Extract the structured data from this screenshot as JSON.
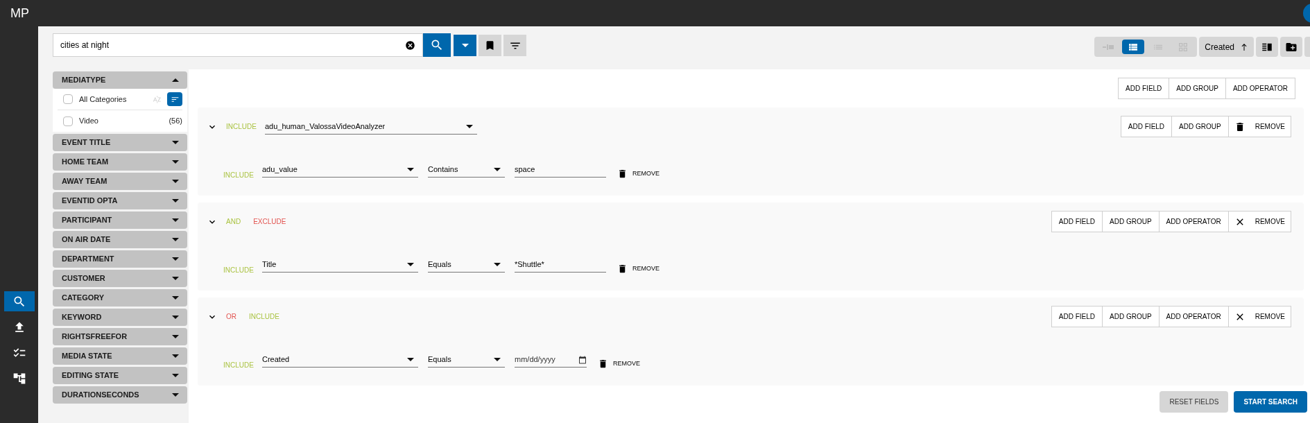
{
  "app": {
    "title": "MP"
  },
  "rail": [
    {
      "kind": "search",
      "selected": true
    },
    {
      "kind": "upload",
      "selected": false
    },
    {
      "kind": "checklist",
      "selected": false
    },
    {
      "kind": "workflow",
      "selected": false
    }
  ],
  "search": {
    "value": "cities at night"
  },
  "view_modes": [
    {
      "kind": "split",
      "selected": false
    },
    {
      "kind": "detail",
      "selected": true
    },
    {
      "kind": "list",
      "selected": false
    },
    {
      "kind": "grid",
      "selected": false
    }
  ],
  "sort": {
    "label": "Created"
  },
  "filters": [
    {
      "label": "MEDIATYPE",
      "expanded": true,
      "options": [
        {
          "kind": "all",
          "label": "All Categories",
          "checked": false
        },
        {
          "kind": "value",
          "label": "Video",
          "count": "(56)",
          "checked": false
        }
      ]
    },
    {
      "label": "EVENT TITLE",
      "expanded": false
    },
    {
      "label": "HOME TEAM",
      "expanded": false
    },
    {
      "label": "AWAY TEAM",
      "expanded": false
    },
    {
      "label": "EVENTID OPTA",
      "expanded": false
    },
    {
      "label": "PARTICIPANT",
      "expanded": false
    },
    {
      "label": "ON AIR DATE",
      "expanded": false
    },
    {
      "label": "DEPARTMENT",
      "expanded": false
    },
    {
      "label": "CUSTOMER",
      "expanded": false
    },
    {
      "label": "CATEGORY",
      "expanded": false
    },
    {
      "label": "KEYWORD",
      "expanded": false
    },
    {
      "label": "RIGHTSFREEFOR",
      "expanded": false
    },
    {
      "label": "MEDIA STATE",
      "expanded": false
    },
    {
      "label": "EDITING STATE",
      "expanded": false
    },
    {
      "label": "DURATIONSECONDS",
      "expanded": false
    }
  ],
  "query": {
    "actions": [
      "ADD FIELD",
      "ADD GROUP",
      "ADD OPERATOR"
    ],
    "groups": [
      {
        "tokens": [
          {
            "label": "INCLUDE",
            "color": "#a9c23f"
          }
        ],
        "field": "adu_human_ValossaVideoAnalyzer",
        "actions": [
          "ADD FIELD",
          "ADD GROUP"
        ],
        "remove": {
          "label": "REMOVE",
          "kind": "trash"
        },
        "conditions": [
          {
            "mode": "INCLUDE",
            "field": "adu_value",
            "comparator": "Contains",
            "kind": "text",
            "value": "space",
            "remove": "REMOVE"
          }
        ]
      },
      {
        "tokens": [
          {
            "label": "AND",
            "color": "#a9c23f"
          },
          {
            "label": "EXCLUDE",
            "color": "#e2534f"
          }
        ],
        "actions": [
          "ADD FIELD",
          "ADD GROUP",
          "ADD OPERATOR"
        ],
        "remove": {
          "label": "REMOVE",
          "kind": "close"
        },
        "conditions": [
          {
            "mode": "INCLUDE",
            "field": "Title",
            "comparator": "Equals",
            "kind": "text",
            "value": "*Shuttle*",
            "remove": "REMOVE"
          }
        ]
      },
      {
        "tokens": [
          {
            "label": "OR",
            "color": "#e2534f"
          },
          {
            "label": "INCLUDE",
            "color": "#a9c23f"
          }
        ],
        "actions": [
          "ADD FIELD",
          "ADD GROUP",
          "ADD OPERATOR"
        ],
        "remove": {
          "label": "REMOVE",
          "kind": "close"
        },
        "conditions": [
          {
            "mode": "INCLUDE",
            "field": "Created",
            "comparator": "Equals",
            "kind": "date",
            "placeholder": "mm/dd/yyyy",
            "remove": "REMOVE"
          }
        ]
      }
    ]
  },
  "footer": {
    "reset": "RESET FIELDS",
    "submit": "START SEARCH"
  }
}
